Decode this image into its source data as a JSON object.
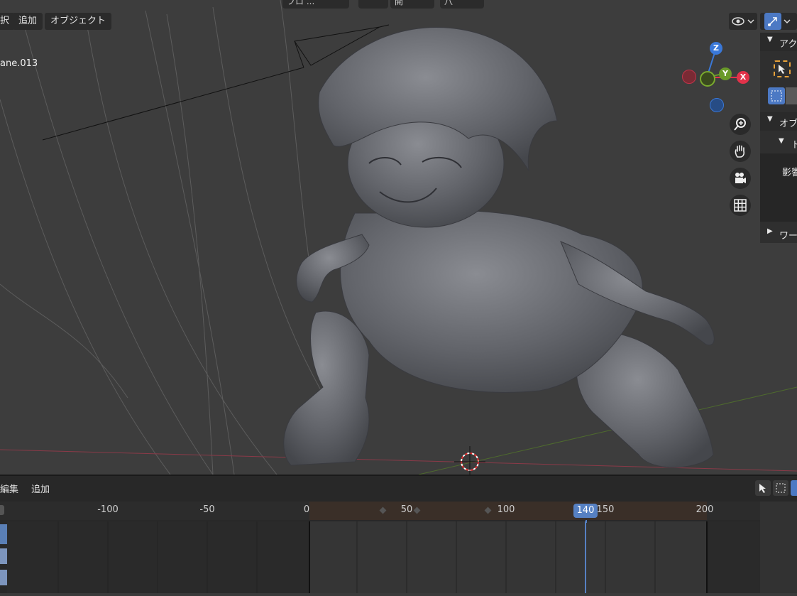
{
  "viewport": {
    "header_menus": [
      {
        "label": "択"
      },
      {
        "label": "追加"
      },
      {
        "label": "オブジェクト"
      }
    ],
    "top_pills": [
      {
        "label": "フロ ..."
      },
      {
        "label": ""
      },
      {
        "label": "開"
      },
      {
        "label": "八"
      }
    ],
    "object_name": "ane.013",
    "gizmo": {
      "z": "Z",
      "y": "Y",
      "x": "X"
    },
    "nav_icons": [
      "zoom-icon",
      "pan-hand-icon",
      "camera-icon",
      "grid-icon"
    ],
    "colors": {
      "x": "#e2324a",
      "y": "#6a9a2a",
      "z": "#3a78d8",
      "background": "#3d3d3d"
    }
  },
  "npanel": {
    "header1": "アク",
    "header2": "オブ",
    "sub": "ト",
    "field": "影響",
    "header3": "ワー"
  },
  "timeline": {
    "menus": [
      {
        "label": "編集"
      },
      {
        "label": "追加"
      }
    ],
    "ticks": [
      "-100",
      "-50",
      "0",
      "50",
      "100",
      "150",
      "200"
    ],
    "current_frame": "140",
    "frame_start": 0,
    "frame_end": 200,
    "accent": "#5680c2"
  }
}
